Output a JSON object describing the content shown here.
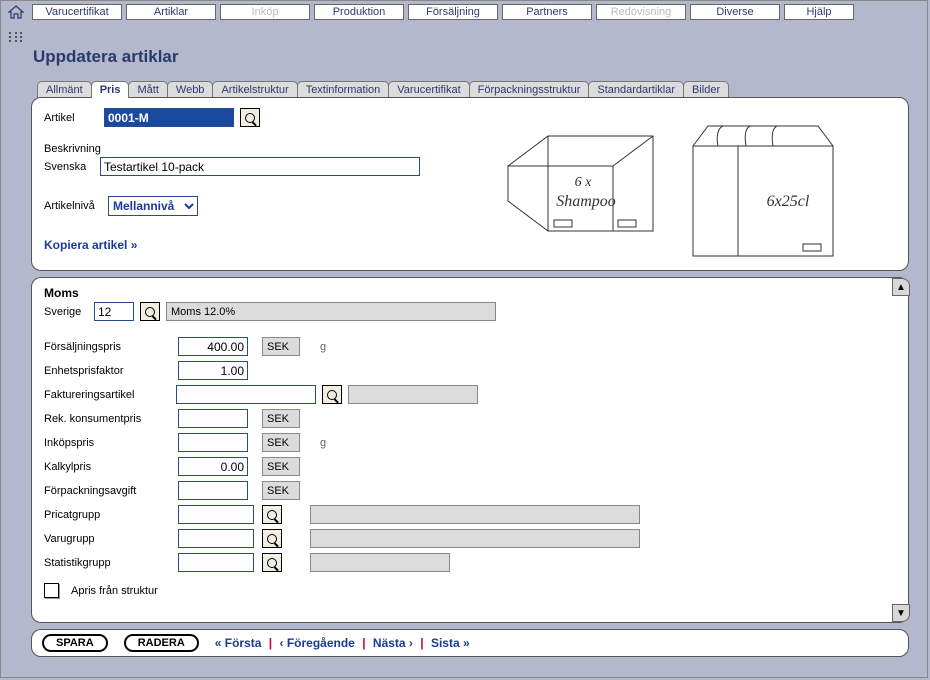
{
  "menu": {
    "home_icon": "home-icon",
    "items": [
      {
        "label": "Varucertifikat",
        "disabled": false
      },
      {
        "label": "Artiklar",
        "disabled": false
      },
      {
        "label": "Inköp",
        "disabled": true
      },
      {
        "label": "Produktion",
        "disabled": false
      },
      {
        "label": "Försäljning",
        "disabled": false
      },
      {
        "label": "Partners",
        "disabled": false
      },
      {
        "label": "Redovisning",
        "disabled": true
      },
      {
        "label": "Diverse",
        "disabled": false
      },
      {
        "label": "Hjälp",
        "disabled": false
      }
    ]
  },
  "page_title": "Uppdatera artiklar",
  "tabs": [
    {
      "label": "Allmänt"
    },
    {
      "label": "Pris",
      "active": true
    },
    {
      "label": "Mått"
    },
    {
      "label": "Webb"
    },
    {
      "label": "Artikelstruktur"
    },
    {
      "label": "Textinformation"
    },
    {
      "label": "Varucertifikat"
    },
    {
      "label": "Förpackningsstruktur"
    },
    {
      "label": "Standardartiklar"
    },
    {
      "label": "Bilder"
    }
  ],
  "top_panel": {
    "artikel_label": "Artikel",
    "artikel_value": "0001-M",
    "beskrivning_label": "Beskrivning",
    "svenska_label": "Svenska",
    "svenska_value": "Testartikel 10-pack",
    "artikelniva_label": "Artikelnivå",
    "artikelniva_value": "Mellannivå",
    "kopiera_link": "Kopiera artikel »",
    "illus_text_box": "6 x Shampoo",
    "illus_text_pack": "6x25cl"
  },
  "moms": {
    "section": "Moms",
    "country_label": "Sverige",
    "rate": "12",
    "display": "Moms 12.0%"
  },
  "fields": {
    "forsaljningspris_label": "Försäljningspris",
    "forsaljningspris_value": "400.00",
    "currency": "SEK",
    "unit_hint": "g",
    "enhetsprisfaktor_label": "Enhetsprisfaktor",
    "enhetsprisfaktor_value": "1.00",
    "faktureringsartikel_label": "Faktureringsartikel",
    "faktureringsartikel_value": "",
    "faktureringsartikel_disp": "",
    "rek_label": "Rek. konsumentpris",
    "rek_value": "",
    "inkop_label": "Inköpspris",
    "inkop_value": "",
    "kalkyl_label": "Kalkylpris",
    "kalkyl_value": "0.00",
    "forpack_label": "Förpackningsavgift",
    "forpack_value": "",
    "pricat_label": "Pricatgrupp",
    "pricat_value": "",
    "pricat_disp": "",
    "varu_label": "Varugrupp",
    "varu_value": "",
    "varu_disp": "",
    "stat_label": "Statistikgrupp",
    "stat_value": "",
    "stat_disp": "",
    "apris_label": "Apris från struktur",
    "apris_checked": false
  },
  "footer": {
    "save": "SPARA",
    "delete": "RADERA",
    "nav_first": "« Första",
    "nav_prev": "‹ Föregående",
    "nav_next": "Nästa ›",
    "nav_last": "Sista »"
  }
}
